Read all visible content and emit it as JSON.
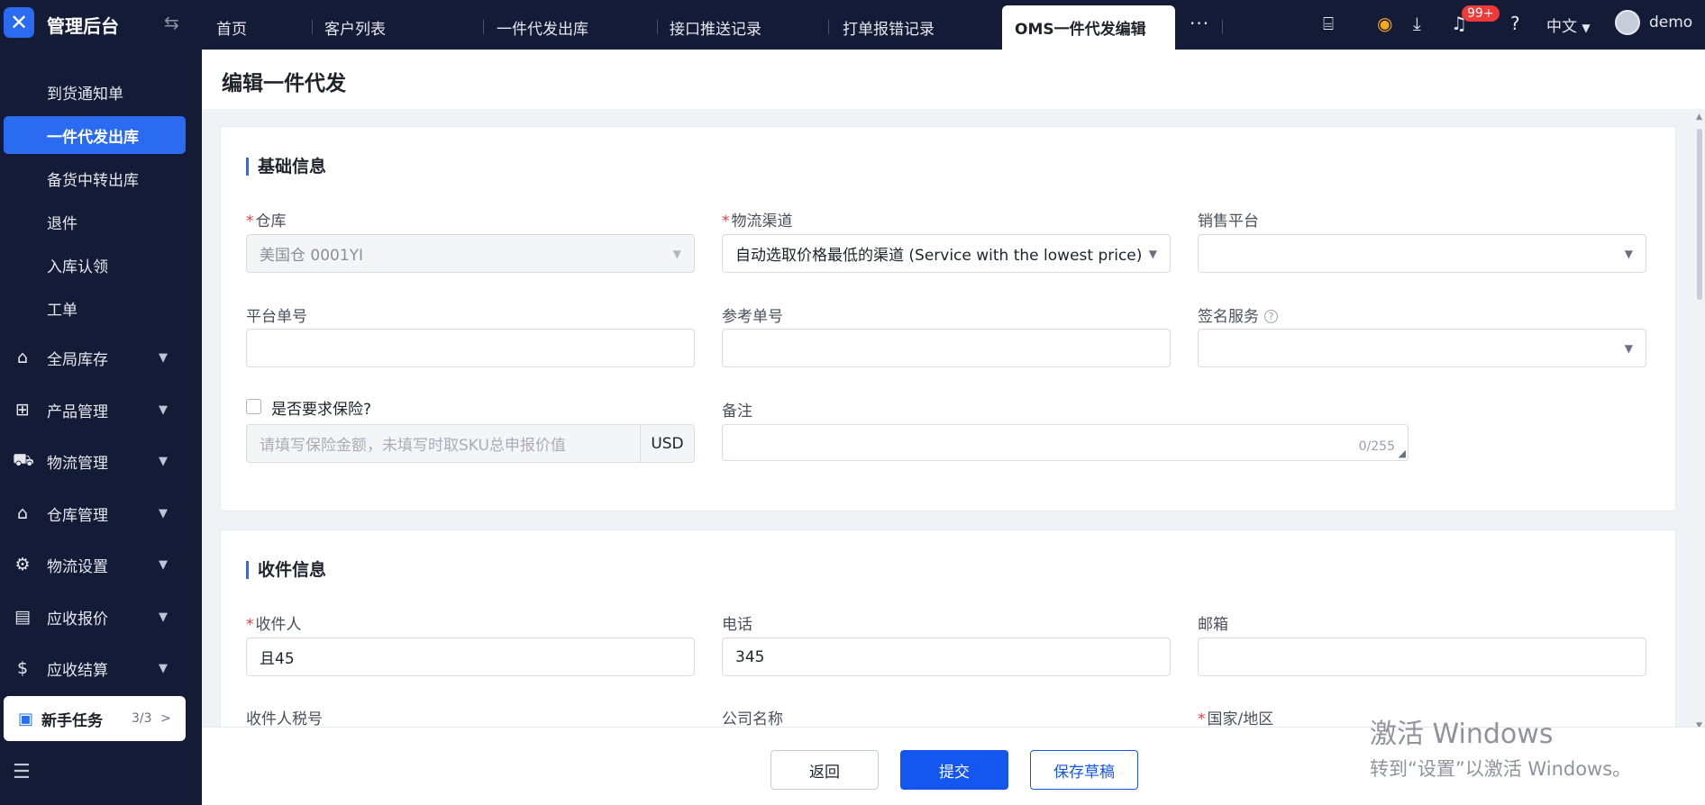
{
  "app": {
    "logo_glyph": "✕",
    "title": "管理后台",
    "accent": "#2a6bf2"
  },
  "tabs": [
    {
      "label": "首页"
    },
    {
      "label": "客户列表"
    },
    {
      "label": "一件代发出库"
    },
    {
      "label": "接口推送记录"
    },
    {
      "label": "打单报错记录"
    },
    {
      "label": "OMS一件代发编辑",
      "active": true
    }
  ],
  "topbar": {
    "more": "···",
    "badge": "99+",
    "language": "中文",
    "user": "demo"
  },
  "sidebar": {
    "sub_items": [
      {
        "label": "到货通知单"
      },
      {
        "label": "一件代发出库",
        "active": true
      },
      {
        "label": "备货中转出库"
      },
      {
        "label": "退件"
      },
      {
        "label": "入库认领"
      },
      {
        "label": "工单"
      }
    ],
    "groups": [
      {
        "label": "全局库存",
        "icon": "warehouse-icon"
      },
      {
        "label": "产品管理",
        "icon": "bag-icon"
      },
      {
        "label": "物流管理",
        "icon": "truck-icon"
      },
      {
        "label": "仓库管理",
        "icon": "house-icon"
      },
      {
        "label": "物流设置",
        "icon": "box-gear-icon"
      },
      {
        "label": "应收报价",
        "icon": "document-icon"
      },
      {
        "label": "应收结算",
        "icon": "dollar-icon"
      }
    ],
    "newbie": {
      "label": "新手任务",
      "count": "3/3"
    }
  },
  "page": {
    "title": "编辑一件代发"
  },
  "basic": {
    "title": "基础信息",
    "warehouse": {
      "label": "仓库",
      "value": "美国仓 0001YI"
    },
    "channel": {
      "label": "物流渠道",
      "value": "自动选取价格最低的渠道 (Service with the lowest price)"
    },
    "platform": {
      "label": "销售平台",
      "value": ""
    },
    "platform_no": {
      "label": "平台单号",
      "value": ""
    },
    "ref_no": {
      "label": "参考单号",
      "value": ""
    },
    "signature": {
      "label": "签名服务",
      "value": ""
    },
    "insurance": {
      "label": "是否要求保险?",
      "placeholder": "请填写保险金额，未填写时取SKU总申报价值",
      "currency": "USD"
    },
    "remark": {
      "label": "备注",
      "counter": "0/255"
    }
  },
  "receiver": {
    "title": "收件信息",
    "name": {
      "label": "收件人",
      "value": "且45"
    },
    "phone": {
      "label": "电话",
      "value": "345"
    },
    "email": {
      "label": "邮箱",
      "value": ""
    },
    "tax_no": {
      "label": "收件人税号"
    },
    "company": {
      "label": "公司名称"
    },
    "country": {
      "label": "国家/地区"
    }
  },
  "footer": {
    "back": "返回",
    "submit": "提交",
    "draft": "保存草稿"
  },
  "watermark": {
    "line1": "激活 Windows",
    "line2": "转到“设置”以激活 Windows。"
  }
}
